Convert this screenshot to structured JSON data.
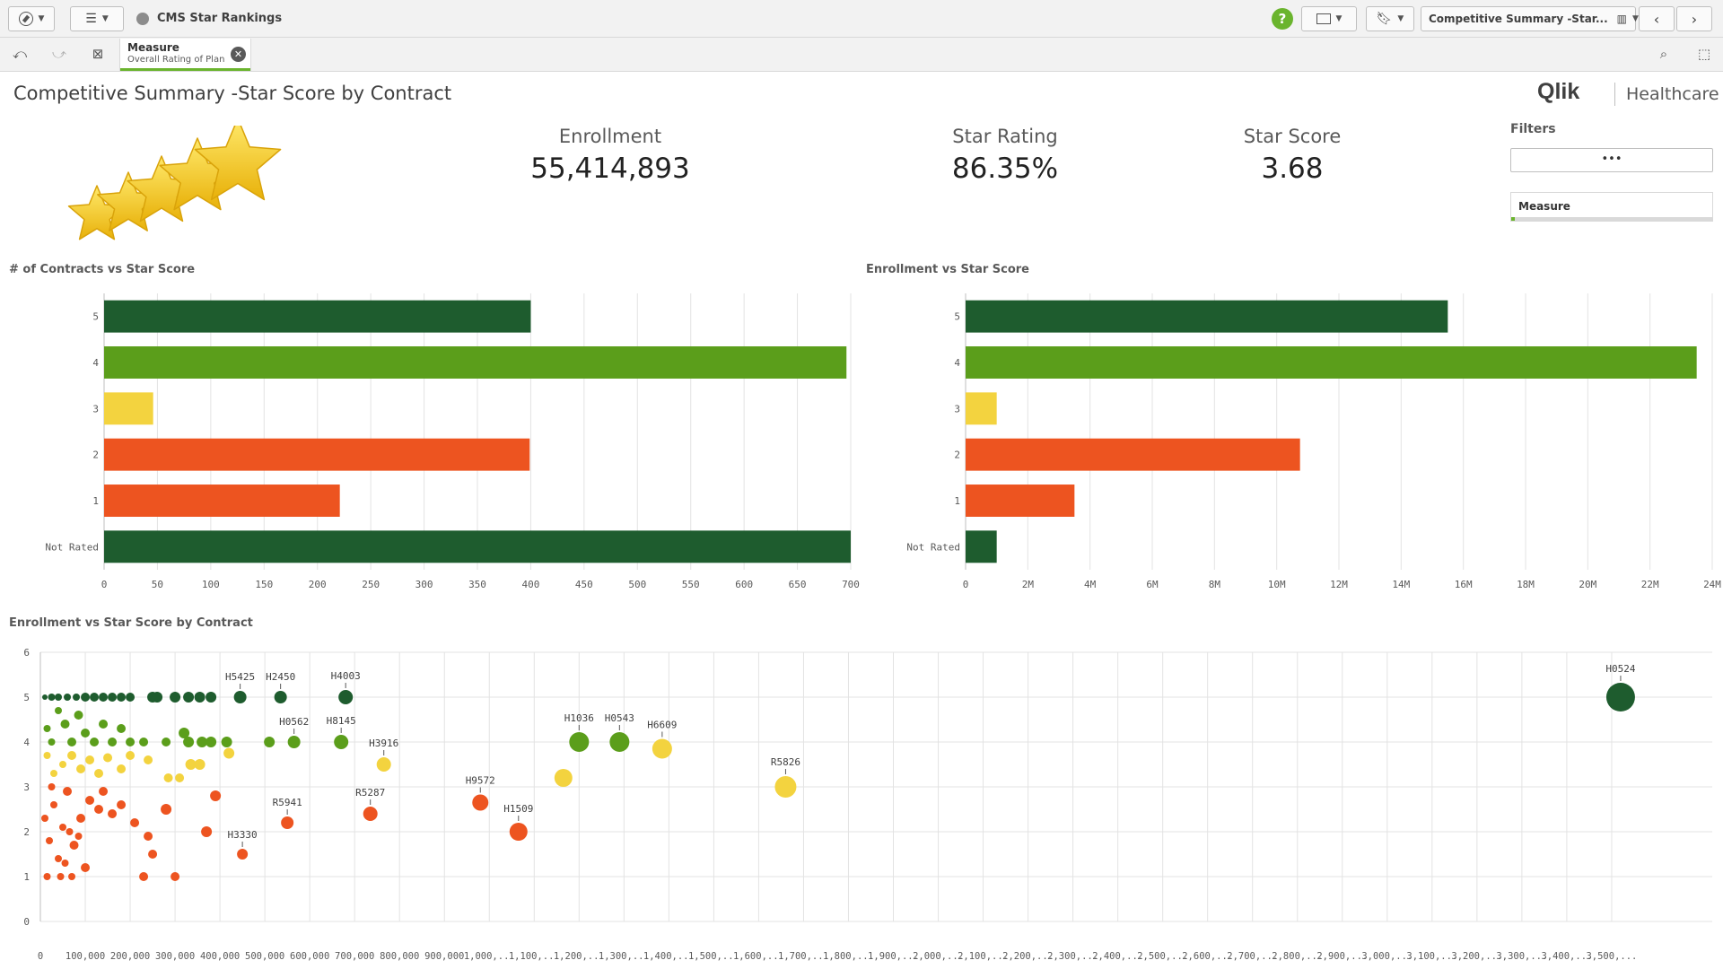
{
  "app": {
    "title": "CMS Star Rankings",
    "sheet_selector": "Competitive Summary -Star..."
  },
  "selection": {
    "field": "Measure",
    "value": "Overall Rating of Plan"
  },
  "sheet": {
    "title": "Competitive Summary -Star Score by Contract"
  },
  "brand": {
    "logo": "Qlik",
    "sub": "Healthcare"
  },
  "kpis": [
    {
      "label": "Enrollment",
      "value": "55,414,893"
    },
    {
      "label": "Star Rating",
      "value": "86.35%"
    },
    {
      "label": "Star Score",
      "value": "3.68"
    }
  ],
  "filters": {
    "title": "Filters",
    "more_label": "•••",
    "measure_label": "Measure"
  },
  "colors": {
    "dark_green": "#1e5c2e",
    "green": "#5b9e1b",
    "yellow": "#f3d33f",
    "orange": "#ed5420",
    "help": "#6ab42d"
  },
  "icons": [
    "compass-icon",
    "list-icon",
    "app-globe-icon",
    "help-icon",
    "present-icon",
    "bookmark-icon",
    "sheet-chart-icon",
    "back-icon",
    "forward-icon",
    "smart-search-icon",
    "selections-tool-icon",
    "step-back-icon",
    "step-forward-icon",
    "clear-selections-icon",
    "close-icon"
  ],
  "chart_data": [
    {
      "type": "bar",
      "title": "# of Contracts vs Star Score",
      "categories": [
        "5",
        "4",
        "3",
        "2",
        "1",
        "Not Rated"
      ],
      "values": [
        400,
        696,
        46,
        399,
        221,
        700
      ],
      "colors": [
        "#1e5c2e",
        "#5b9e1b",
        "#f3d33f",
        "#ed5420",
        "#ed5420",
        "#1e5c2e"
      ],
      "xlim": [
        0,
        700
      ],
      "xticks": [
        "0",
        "50",
        "100",
        "150",
        "200",
        "250",
        "300",
        "350",
        "400",
        "450",
        "500",
        "550",
        "600",
        "650",
        "700"
      ],
      "grid": true
    },
    {
      "type": "bar",
      "title": "Enrollment vs Star Score",
      "categories": [
        "5",
        "4",
        "3",
        "2",
        "1",
        "Not Rated"
      ],
      "values": [
        15500000,
        23500000,
        1000000,
        10750000,
        3500000,
        1000000
      ],
      "colors": [
        "#1e5c2e",
        "#5b9e1b",
        "#f3d33f",
        "#ed5420",
        "#ed5420",
        "#1e5c2e"
      ],
      "xlim": [
        0,
        24000000
      ],
      "xticks": [
        "0",
        "2M",
        "4M",
        "6M",
        "8M",
        "10M",
        "12M",
        "14M",
        "16M",
        "18M",
        "20M",
        "22M",
        "24M"
      ],
      "grid": true
    },
    {
      "type": "scatter",
      "title": "Enrollment vs Star Score by Contract",
      "xlim": [
        0,
        3600000
      ],
      "ylim": [
        0,
        6
      ],
      "yticks": [
        "0",
        "1",
        "2",
        "3",
        "4",
        "5",
        "6"
      ],
      "xticks": [
        "0",
        "100,000",
        "200,000",
        "300,000",
        "400,000",
        "500,000",
        "600,000",
        "700,000",
        "800,000",
        "900,000",
        "1,000,...",
        "1,100,...",
        "1,200,...",
        "1,300,...",
        "1,400,...",
        "1,500,...",
        "1,600,...",
        "1,700,...",
        "1,800,...",
        "1,900,...",
        "2,000,...",
        "2,100,...",
        "2,200,...",
        "2,300,...",
        "2,400,...",
        "2,500,...",
        "2,600,...",
        "2,700,...",
        "2,800,...",
        "2,900,...",
        "3,000,...",
        "3,100,...",
        "3,200,...",
        "3,300,...",
        "3,400,...",
        "3,500,..."
      ],
      "grid": true,
      "points": [
        {
          "label": "H0524",
          "x": 3520000,
          "y": 5,
          "r": 16,
          "color": "#1e5c2e"
        },
        {
          "label": "H5425",
          "x": 445000,
          "y": 5,
          "r": 7,
          "color": "#1e5c2e"
        },
        {
          "label": "H2450",
          "x": 535000,
          "y": 5,
          "r": 7,
          "color": "#1e5c2e"
        },
        {
          "label": "H4003",
          "x": 680000,
          "y": 5,
          "r": 8,
          "color": "#1e5c2e"
        },
        {
          "label": "H0562",
          "x": 565000,
          "y": 4,
          "r": 7,
          "color": "#5b9e1b"
        },
        {
          "label": "H8145",
          "x": 670000,
          "y": 4,
          "r": 8,
          "color": "#5b9e1b"
        },
        {
          "label": "H3916",
          "x": 765000,
          "y": 3.5,
          "r": 8,
          "color": "#f3d33f"
        },
        {
          "label": "H1036",
          "x": 1200000,
          "y": 4,
          "r": 11,
          "color": "#5b9e1b"
        },
        {
          "label": "H0543",
          "x": 1290000,
          "y": 4,
          "r": 11,
          "color": "#5b9e1b"
        },
        {
          "label": "H6609",
          "x": 1385000,
          "y": 3.85,
          "r": 11,
          "color": "#f3d33f"
        },
        {
          "label": "R5826",
          "x": 1660000,
          "y": 3,
          "r": 12,
          "color": "#f3d33f"
        },
        {
          "label": "H9572",
          "x": 980000,
          "y": 2.65,
          "r": 9,
          "color": "#ed5420"
        },
        {
          "label": "H1509",
          "x": 1065000,
          "y": 2,
          "r": 10,
          "color": "#ed5420"
        },
        {
          "label": "R5287",
          "x": 735000,
          "y": 2.4,
          "r": 8,
          "color": "#ed5420"
        },
        {
          "label": "R5941",
          "x": 550000,
          "y": 2.2,
          "r": 7,
          "color": "#ed5420"
        },
        {
          "label": "H3330",
          "x": 450000,
          "y": 1.5,
          "r": 6,
          "color": "#ed5420"
        },
        {
          "label": "",
          "x": 1165000,
          "y": 3.2,
          "r": 10,
          "color": "#f3d33f"
        },
        {
          "label": "",
          "x": 510000,
          "y": 4,
          "r": 6,
          "color": "#5b9e1b"
        },
        {
          "label": "",
          "x": 415000,
          "y": 4,
          "r": 6,
          "color": "#5b9e1b"
        },
        {
          "label": "",
          "x": 420000,
          "y": 3.75,
          "r": 6,
          "color": "#f3d33f"
        },
        {
          "label": "",
          "x": 330000,
          "y": 5,
          "r": 6,
          "color": "#1e5c2e"
        },
        {
          "label": "",
          "x": 355000,
          "y": 5,
          "r": 6,
          "color": "#1e5c2e"
        },
        {
          "label": "",
          "x": 380000,
          "y": 5,
          "r": 6,
          "color": "#1e5c2e"
        },
        {
          "label": "",
          "x": 300000,
          "y": 5,
          "r": 6,
          "color": "#1e5c2e"
        },
        {
          "label": "",
          "x": 260000,
          "y": 5,
          "r": 6,
          "color": "#1e5c2e"
        },
        {
          "label": "",
          "x": 250000,
          "y": 5,
          "r": 6,
          "color": "#1e5c2e"
        },
        {
          "label": "",
          "x": 200000,
          "y": 5,
          "r": 5,
          "color": "#1e5c2e"
        },
        {
          "label": "",
          "x": 180000,
          "y": 5,
          "r": 5,
          "color": "#1e5c2e"
        },
        {
          "label": "",
          "x": 160000,
          "y": 5,
          "r": 5,
          "color": "#1e5c2e"
        },
        {
          "label": "",
          "x": 140000,
          "y": 5,
          "r": 5,
          "color": "#1e5c2e"
        },
        {
          "label": "",
          "x": 120000,
          "y": 5,
          "r": 5,
          "color": "#1e5c2e"
        },
        {
          "label": "",
          "x": 100000,
          "y": 5,
          "r": 5,
          "color": "#1e5c2e"
        },
        {
          "label": "",
          "x": 80000,
          "y": 5,
          "r": 4,
          "color": "#1e5c2e"
        },
        {
          "label": "",
          "x": 60000,
          "y": 5,
          "r": 4,
          "color": "#1e5c2e"
        },
        {
          "label": "",
          "x": 40000,
          "y": 5,
          "r": 4,
          "color": "#1e5c2e"
        },
        {
          "label": "",
          "x": 25000,
          "y": 5,
          "r": 4,
          "color": "#1e5c2e"
        },
        {
          "label": "",
          "x": 10000,
          "y": 5,
          "r": 3,
          "color": "#1e5c2e"
        },
        {
          "label": "",
          "x": 280000,
          "y": 4,
          "r": 5,
          "color": "#5b9e1b"
        },
        {
          "label": "",
          "x": 330000,
          "y": 4,
          "r": 6,
          "color": "#5b9e1b"
        },
        {
          "label": "",
          "x": 360000,
          "y": 4,
          "r": 6,
          "color": "#5b9e1b"
        },
        {
          "label": "",
          "x": 380000,
          "y": 4,
          "r": 6,
          "color": "#5b9e1b"
        },
        {
          "label": "",
          "x": 320000,
          "y": 4.2,
          "r": 6,
          "color": "#5b9e1b"
        },
        {
          "label": "",
          "x": 230000,
          "y": 4,
          "r": 5,
          "color": "#5b9e1b"
        },
        {
          "label": "",
          "x": 200000,
          "y": 4,
          "r": 5,
          "color": "#5b9e1b"
        },
        {
          "label": "",
          "x": 180000,
          "y": 4.3,
          "r": 5,
          "color": "#5b9e1b"
        },
        {
          "label": "",
          "x": 160000,
          "y": 4,
          "r": 5,
          "color": "#5b9e1b"
        },
        {
          "label": "",
          "x": 140000,
          "y": 4.4,
          "r": 5,
          "color": "#5b9e1b"
        },
        {
          "label": "",
          "x": 120000,
          "y": 4,
          "r": 5,
          "color": "#5b9e1b"
        },
        {
          "label": "",
          "x": 100000,
          "y": 4.2,
          "r": 5,
          "color": "#5b9e1b"
        },
        {
          "label": "",
          "x": 85000,
          "y": 4.6,
          "r": 5,
          "color": "#5b9e1b"
        },
        {
          "label": "",
          "x": 70000,
          "y": 4,
          "r": 5,
          "color": "#5b9e1b"
        },
        {
          "label": "",
          "x": 55000,
          "y": 4.4,
          "r": 5,
          "color": "#5b9e1b"
        },
        {
          "label": "",
          "x": 40000,
          "y": 4.7,
          "r": 4,
          "color": "#5b9e1b"
        },
        {
          "label": "",
          "x": 25000,
          "y": 4,
          "r": 4,
          "color": "#5b9e1b"
        },
        {
          "label": "",
          "x": 15000,
          "y": 4.3,
          "r": 4,
          "color": "#5b9e1b"
        },
        {
          "label": "",
          "x": 240000,
          "y": 3.6,
          "r": 5,
          "color": "#f3d33f"
        },
        {
          "label": "",
          "x": 200000,
          "y": 3.7,
          "r": 5,
          "color": "#f3d33f"
        },
        {
          "label": "",
          "x": 180000,
          "y": 3.4,
          "r": 5,
          "color": "#f3d33f"
        },
        {
          "label": "",
          "x": 150000,
          "y": 3.65,
          "r": 5,
          "color": "#f3d33f"
        },
        {
          "label": "",
          "x": 130000,
          "y": 3.3,
          "r": 5,
          "color": "#f3d33f"
        },
        {
          "label": "",
          "x": 110000,
          "y": 3.6,
          "r": 5,
          "color": "#f3d33f"
        },
        {
          "label": "",
          "x": 90000,
          "y": 3.4,
          "r": 5,
          "color": "#f3d33f"
        },
        {
          "label": "",
          "x": 70000,
          "y": 3.7,
          "r": 5,
          "color": "#f3d33f"
        },
        {
          "label": "",
          "x": 50000,
          "y": 3.5,
          "r": 4,
          "color": "#f3d33f"
        },
        {
          "label": "",
          "x": 30000,
          "y": 3.3,
          "r": 4,
          "color": "#f3d33f"
        },
        {
          "label": "",
          "x": 15000,
          "y": 3.7,
          "r": 4,
          "color": "#f3d33f"
        },
        {
          "label": "",
          "x": 335000,
          "y": 3.5,
          "r": 6,
          "color": "#f3d33f"
        },
        {
          "label": "",
          "x": 355000,
          "y": 3.5,
          "r": 6,
          "color": "#f3d33f"
        },
        {
          "label": "",
          "x": 285000,
          "y": 3.2,
          "r": 5,
          "color": "#f3d33f"
        },
        {
          "label": "",
          "x": 310000,
          "y": 3.2,
          "r": 5,
          "color": "#f3d33f"
        },
        {
          "label": "",
          "x": 390000,
          "y": 2.8,
          "r": 6,
          "color": "#ed5420"
        },
        {
          "label": "",
          "x": 370000,
          "y": 2,
          "r": 6,
          "color": "#ed5420"
        },
        {
          "label": "",
          "x": 300000,
          "y": 1,
          "r": 5,
          "color": "#ed5420"
        },
        {
          "label": "",
          "x": 280000,
          "y": 2.5,
          "r": 6,
          "color": "#ed5420"
        },
        {
          "label": "",
          "x": 250000,
          "y": 1.5,
          "r": 5,
          "color": "#ed5420"
        },
        {
          "label": "",
          "x": 240000,
          "y": 1.9,
          "r": 5,
          "color": "#ed5420"
        },
        {
          "label": "",
          "x": 230000,
          "y": 1,
          "r": 5,
          "color": "#ed5420"
        },
        {
          "label": "",
          "x": 210000,
          "y": 2.2,
          "r": 5,
          "color": "#ed5420"
        },
        {
          "label": "",
          "x": 180000,
          "y": 2.6,
          "r": 5,
          "color": "#ed5420"
        },
        {
          "label": "",
          "x": 160000,
          "y": 2.4,
          "r": 5,
          "color": "#ed5420"
        },
        {
          "label": "",
          "x": 140000,
          "y": 2.9,
          "r": 5,
          "color": "#ed5420"
        },
        {
          "label": "",
          "x": 130000,
          "y": 2.5,
          "r": 5,
          "color": "#ed5420"
        },
        {
          "label": "",
          "x": 110000,
          "y": 2.7,
          "r": 5,
          "color": "#ed5420"
        },
        {
          "label": "",
          "x": 100000,
          "y": 1.2,
          "r": 5,
          "color": "#ed5420"
        },
        {
          "label": "",
          "x": 90000,
          "y": 2.3,
          "r": 5,
          "color": "#ed5420"
        },
        {
          "label": "",
          "x": 75000,
          "y": 1.7,
          "r": 5,
          "color": "#ed5420"
        },
        {
          "label": "",
          "x": 60000,
          "y": 2.9,
          "r": 5,
          "color": "#ed5420"
        },
        {
          "label": "",
          "x": 50000,
          "y": 2.1,
          "r": 4,
          "color": "#ed5420"
        },
        {
          "label": "",
          "x": 40000,
          "y": 1.4,
          "r": 4,
          "color": "#ed5420"
        },
        {
          "label": "",
          "x": 30000,
          "y": 2.6,
          "r": 4,
          "color": "#ed5420"
        },
        {
          "label": "",
          "x": 20000,
          "y": 1.8,
          "r": 4,
          "color": "#ed5420"
        },
        {
          "label": "",
          "x": 10000,
          "y": 2.3,
          "r": 4,
          "color": "#ed5420"
        },
        {
          "label": "",
          "x": 15000,
          "y": 1,
          "r": 4,
          "color": "#ed5420"
        },
        {
          "label": "",
          "x": 45000,
          "y": 1,
          "r": 4,
          "color": "#ed5420"
        },
        {
          "label": "",
          "x": 70000,
          "y": 1,
          "r": 4,
          "color": "#ed5420"
        },
        {
          "label": "",
          "x": 65000,
          "y": 2,
          "r": 4,
          "color": "#ed5420"
        },
        {
          "label": "",
          "x": 85000,
          "y": 1.9,
          "r": 4,
          "color": "#ed5420"
        },
        {
          "label": "",
          "x": 25000,
          "y": 3,
          "r": 4,
          "color": "#ed5420"
        },
        {
          "label": "",
          "x": 55000,
          "y": 1.3,
          "r": 4,
          "color": "#ed5420"
        }
      ]
    }
  ]
}
